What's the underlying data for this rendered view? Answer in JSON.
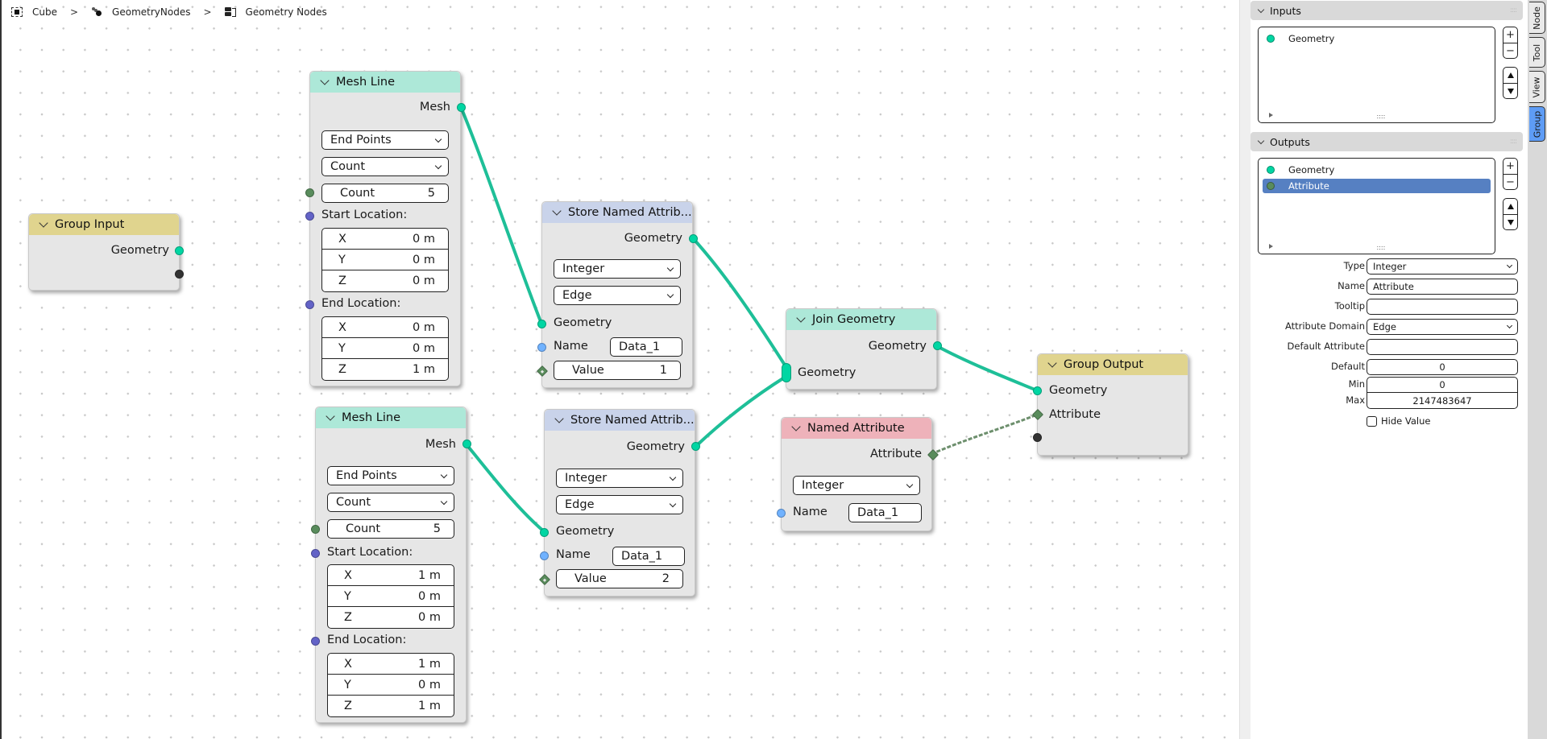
{
  "breadcrumb": {
    "items": [
      {
        "icon": "object-icon",
        "label": "Cube"
      },
      {
        "icon": "modifier-icon",
        "label": "GeometryNodes"
      },
      {
        "icon": "node-tree-icon",
        "label": "Geometry Nodes"
      }
    ],
    "separator": ">"
  },
  "colors": {
    "geometry_socket": "#00d6a3",
    "integer_socket": "#598c5c",
    "vector_socket": "#6363c7",
    "string_socket": "#70b2ff",
    "header_group": "#e0d48e",
    "header_geometry": "#ade8d8",
    "header_attribute": "#c9d3ea",
    "header_input": "#eeb2ba",
    "selection": "#5680c2",
    "active_tab": "#5e9cf5"
  },
  "nodes": {
    "group_input": {
      "title": "Group Input",
      "outputs": [
        "Geometry"
      ]
    },
    "mesh_line_1": {
      "title": "Mesh Line",
      "output": "Mesh",
      "mode": "End Points",
      "count_mode": "Count",
      "count_label": "Count",
      "count_value": "5",
      "start_label": "Start Location:",
      "start": [
        {
          "axis": "X",
          "value": "0 m"
        },
        {
          "axis": "Y",
          "value": "0 m"
        },
        {
          "axis": "Z",
          "value": "0 m"
        }
      ],
      "end_label": "End Location:",
      "end": [
        {
          "axis": "X",
          "value": "0 m"
        },
        {
          "axis": "Y",
          "value": "0 m"
        },
        {
          "axis": "Z",
          "value": "1 m"
        }
      ]
    },
    "mesh_line_2": {
      "title": "Mesh Line",
      "output": "Mesh",
      "mode": "End Points",
      "count_mode": "Count",
      "count_label": "Count",
      "count_value": "5",
      "start_label": "Start Location:",
      "start": [
        {
          "axis": "X",
          "value": "1 m"
        },
        {
          "axis": "Y",
          "value": "0 m"
        },
        {
          "axis": "Z",
          "value": "0 m"
        }
      ],
      "end_label": "End Location:",
      "end": [
        {
          "axis": "X",
          "value": "1 m"
        },
        {
          "axis": "Y",
          "value": "0 m"
        },
        {
          "axis": "Z",
          "value": "1 m"
        }
      ]
    },
    "store_attr_1": {
      "title": "Store Named Attrib...",
      "output": "Geometry",
      "data_type": "Integer",
      "domain": "Edge",
      "geometry_label": "Geometry",
      "name_label": "Name",
      "name_value": "Data_1",
      "value_label": "Value",
      "value": "1"
    },
    "store_attr_2": {
      "title": "Store Named Attrib...",
      "output": "Geometry",
      "data_type": "Integer",
      "domain": "Edge",
      "geometry_label": "Geometry",
      "name_label": "Name",
      "name_value": "Data_1",
      "value_label": "Value",
      "value": "2"
    },
    "join_geometry": {
      "title": "Join Geometry",
      "output": "Geometry",
      "input": "Geometry"
    },
    "named_attribute": {
      "title": "Named Attribute",
      "output": "Attribute",
      "data_type": "Integer",
      "name_label": "Name",
      "name_value": "Data_1"
    },
    "group_output": {
      "title": "Group Output",
      "inputs": [
        "Geometry",
        "Attribute"
      ]
    }
  },
  "sidebar": {
    "inputs_panel": {
      "title": "Inputs",
      "items": [
        {
          "label": "Geometry",
          "color": "#00d6a3",
          "selected": false
        }
      ]
    },
    "outputs_panel": {
      "title": "Outputs",
      "items": [
        {
          "label": "Geometry",
          "color": "#00d6a3",
          "selected": false
        },
        {
          "label": "Attribute",
          "color": "#598c5c",
          "selected": true
        }
      ]
    },
    "list_buttons": {
      "add": "+",
      "remove": "−"
    },
    "properties": [
      {
        "label": "Type",
        "value": "Integer",
        "kind": "select"
      },
      {
        "label": "Name",
        "value": "Attribute",
        "kind": "text"
      },
      {
        "label": "Tooltip",
        "value": "",
        "kind": "text"
      },
      {
        "label": "Attribute Domain",
        "value": "Edge",
        "kind": "select"
      },
      {
        "label": "Default Attribute",
        "value": "",
        "kind": "text"
      },
      {
        "label": "Default",
        "value": "0",
        "kind": "number"
      },
      {
        "label": "Min",
        "value": "0",
        "kind": "number"
      },
      {
        "label": "Max",
        "value": "2147483647",
        "kind": "number"
      }
    ],
    "hide_value": {
      "label": "Hide Value",
      "checked": false
    }
  },
  "tabs": [
    {
      "label": "Node",
      "active": false
    },
    {
      "label": "Tool",
      "active": false
    },
    {
      "label": "View",
      "active": false
    },
    {
      "label": "Group",
      "active": true
    }
  ]
}
